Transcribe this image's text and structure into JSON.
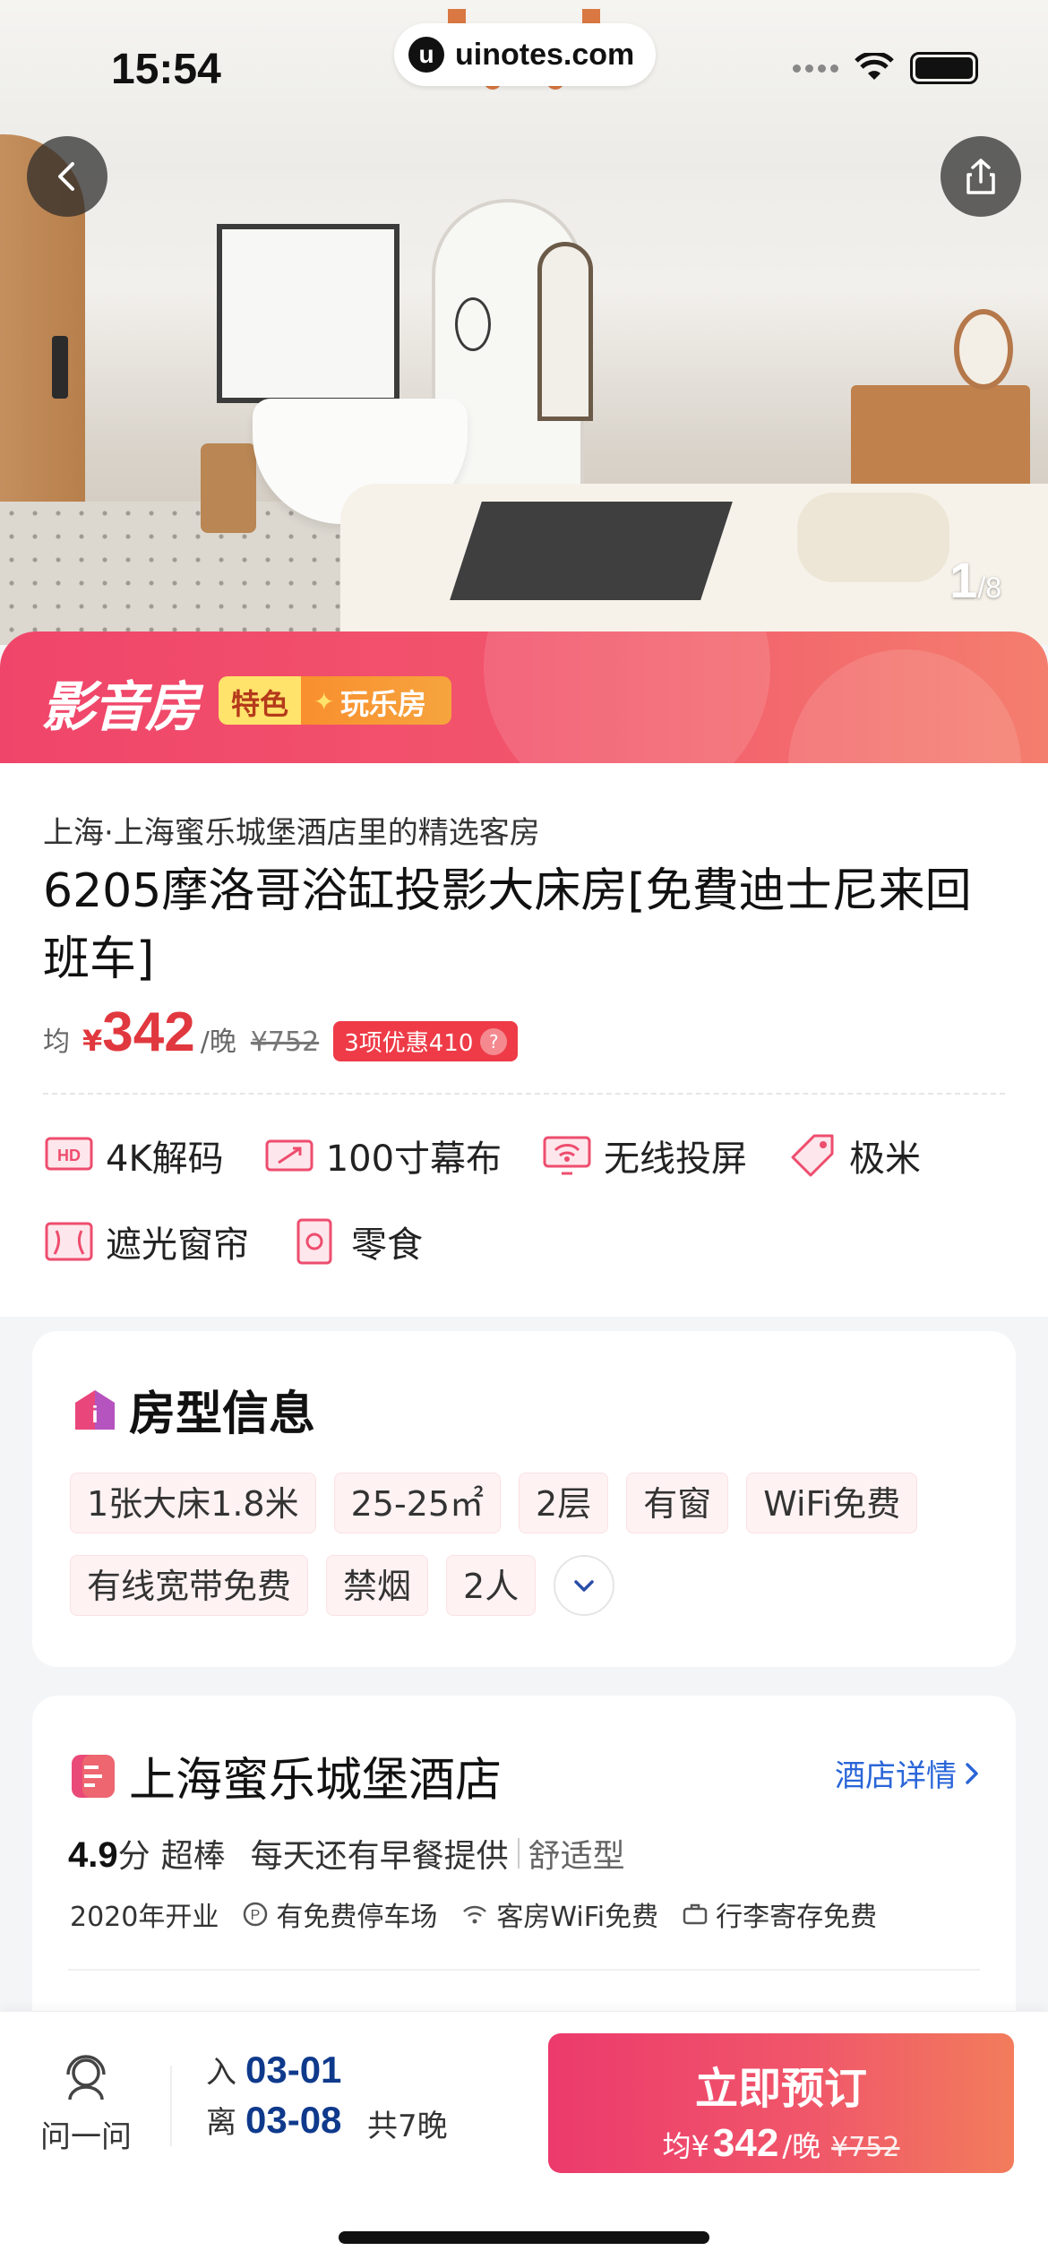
{
  "status": {
    "time": "15:54",
    "url": "uinotes.com",
    "url_logo": "u"
  },
  "gallery": {
    "current": "1",
    "total": "/8"
  },
  "banner": {
    "brand": "影音房",
    "tag_left": "特色",
    "tag_right": "玩乐房"
  },
  "room": {
    "location": "上海·上海蜜乐城堡酒店里的精选客房",
    "title": "6205摩洛哥浴缸投影大床房[免費迪士尼来回班车]",
    "price": {
      "prefix": "均",
      "currency": "¥",
      "amount": "342",
      "unit": "/晚",
      "original": "¥752",
      "discount": "3项优惠410",
      "discount_help": "?"
    },
    "amenities": [
      {
        "icon": "hd-icon",
        "label": "4K解码"
      },
      {
        "icon": "projector-screen-icon",
        "label": "100寸幕布"
      },
      {
        "icon": "wireless-cast-icon",
        "label": "无线投屏"
      },
      {
        "icon": "tag-icon",
        "label": "极米"
      },
      {
        "icon": "curtain-icon",
        "label": "遮光窗帘"
      },
      {
        "icon": "snack-icon",
        "label": "零食"
      }
    ]
  },
  "room_info": {
    "title": "房型信息",
    "chips": [
      "1张大床1.8米",
      "25-25㎡",
      "2层",
      "有窗",
      "WiFi免费",
      "有线宽带免费",
      "禁烟",
      "2人"
    ]
  },
  "hotel": {
    "name": "上海蜜乐城堡酒店",
    "detail_link": "酒店详情",
    "score": "4.9",
    "score_unit": "分",
    "grade": "超棒",
    "feature": "每天还有早餐提供",
    "type": "舒适型",
    "facts": [
      {
        "icon": "calendar-icon",
        "label": "2020年开业"
      },
      {
        "icon": "parking-icon",
        "label": "有免费停车场"
      },
      {
        "icon": "wifi-icon",
        "label": "客房WiFi免费"
      },
      {
        "icon": "luggage-icon",
        "label": "行李寄存免费"
      }
    ]
  },
  "bottom": {
    "ask": "问一问",
    "checkin_label": "入",
    "checkin": "03-01",
    "checkout_label": "离",
    "checkout": "03-08",
    "nights": "共7晚",
    "book": "立即预订",
    "book_prefix": "均¥",
    "book_amount": "342",
    "book_unit": "/晚",
    "book_original": "¥752"
  },
  "colors": {
    "accent": "#f0456a",
    "price": "#e0383e",
    "link": "#2a66d8",
    "date": "#0f3a8c"
  }
}
